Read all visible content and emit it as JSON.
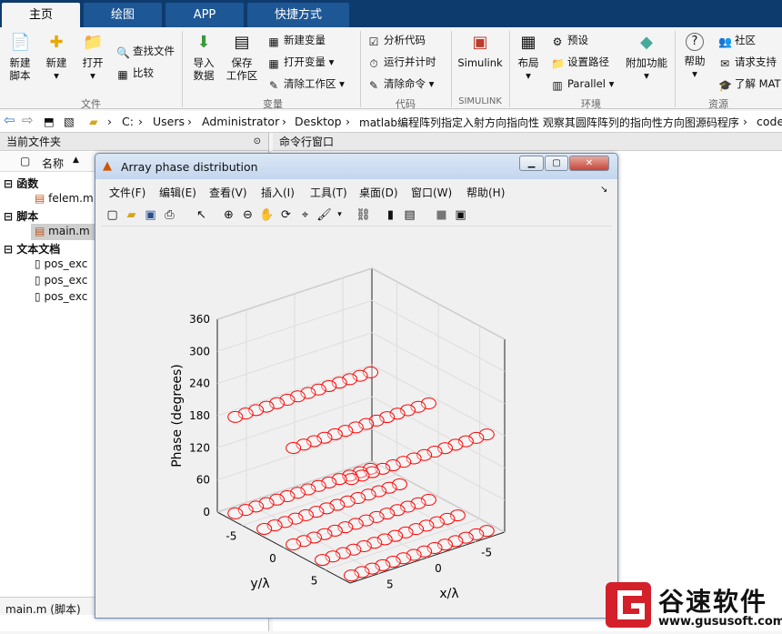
{
  "tabs": [
    "主页",
    "绘图",
    "APP",
    "快捷方式"
  ],
  "ribbon": {
    "new_script": "新建\n脚本",
    "new": "新建",
    "open": "打开",
    "find_files": "查找文件",
    "compare": "比较",
    "import_data": "导入\n数据",
    "save_workspace": "保存\n工作区",
    "new_variable": "新建变量",
    "open_variable": "打开变量",
    "clear_workspace": "清除工作区",
    "analyze_code": "分析代码",
    "run_and_time": "运行并计时",
    "clear_commands": "清除命令",
    "simulink": "Simulink",
    "layout": "布局",
    "preferences": "预设",
    "set_path": "设置路径",
    "parallel": "Parallel",
    "addons": "附加功能",
    "help": "帮助",
    "community": "社区",
    "request_support": "请求支持",
    "learn_matlab": "了解 MAT",
    "group_file": "文件",
    "group_variable": "变量",
    "group_code": "代码",
    "group_simulink": "SIMULINK",
    "group_environment": "环境",
    "group_resources": "资源"
  },
  "address": {
    "drive": "C:",
    "p1": "Users",
    "p2": "Administrator",
    "p3": "Desktop",
    "p4": "matlab编程阵列指定入射方向指向性 观察其圆阵阵列的指向性方向图源码程序",
    "p5": "code"
  },
  "left": {
    "title": "当前文件夹",
    "col_name": "名称",
    "sort": "▲",
    "group1": "函数",
    "file1": "felem.m",
    "group2": "脚本",
    "file2": "main.m",
    "group3": "文本文档",
    "file3": "pos_exc",
    "file4": "pos_exc",
    "file5": "pos_exc",
    "status": "main.m  (脚本)"
  },
  "cmd": {
    "title": "命令行窗口"
  },
  "figure": {
    "title": "Array phase distribution",
    "menus": [
      "文件(F)",
      "编辑(E)",
      "查看(V)",
      "插入(I)",
      "工具(T)",
      "桌面(D)",
      "窗口(W)",
      "帮助(H)"
    ]
  },
  "chart_data": {
    "type": "scatter3d",
    "title": "",
    "xlabel": "x/λ",
    "ylabel": "y/λ",
    "zlabel": "Phase (degrees)",
    "xticks": [
      -5,
      0,
      5
    ],
    "yticks": [
      -5,
      0,
      5
    ],
    "zticks": [
      0,
      60,
      120,
      180,
      240,
      300,
      360
    ],
    "xlim": [
      -8,
      8
    ],
    "ylim": [
      -8,
      8
    ],
    "zlim": [
      0,
      360
    ],
    "grid": true,
    "marker": "o",
    "marker_color": "#ff0000",
    "series": [
      {
        "values_z": 0,
        "x_range": [
          -7,
          7
        ],
        "y_range": [
          -7,
          7
        ],
        "rows": 5,
        "per_row": 14
      },
      {
        "values_z": 180,
        "x_range": [
          -7,
          7
        ],
        "y_range": [
          -7,
          7
        ],
        "rows": 3,
        "per_row": 14
      }
    ]
  },
  "watermark": {
    "text": "谷速软件",
    "url": "www.gususoft.com"
  }
}
